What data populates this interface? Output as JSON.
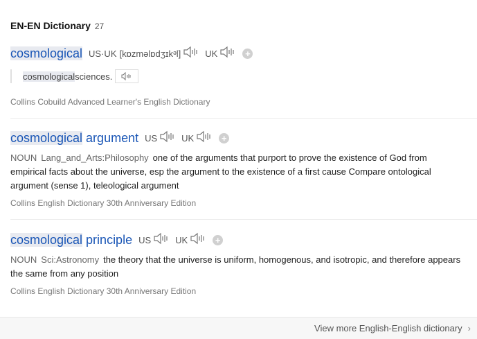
{
  "header": {
    "title": "EN-EN Dictionary",
    "count": "27"
  },
  "entries": [
    {
      "headword_hl": "cosmological",
      "headword_rest": "",
      "us_label": "US·UK",
      "phonetic": "[kɒzməlɒdʒɪkᵊl]",
      "uk_label": "UK",
      "example_hl": "cosmological",
      "example_rest": " sciences.",
      "source": "Collins Cobuild Advanced Learner's English Dictionary"
    },
    {
      "headword_hl": "cosmological",
      "headword_rest": " argument",
      "us_label": "US",
      "uk_label": "UK",
      "pos": "NOUN",
      "domain": "Lang_and_Arts:Philosophy",
      "definition": "one of the arguments that purport to prove the existence of God from empirical facts about the universe, esp the argument to the existence of a first cause Compare ontological argument (sense 1), teleological argument",
      "source": "Collins English Dictionary 30th Anniversary Edition"
    },
    {
      "headword_hl": "cosmological",
      "headword_rest": " principle",
      "us_label": "US",
      "uk_label": "UK",
      "pos": "NOUN",
      "domain": "Sci:Astronomy",
      "definition": "the theory that the universe is uniform, homogenous, and isotropic, and therefore appears the same from any position",
      "source": "Collins English Dictionary 30th Anniversary Edition"
    }
  ],
  "footer": {
    "more_label": "View more English-English dictionary"
  },
  "icons": {
    "speaker": "speaker-icon",
    "add": "plus-icon",
    "chevron": "chevron-right-icon"
  },
  "colors": {
    "headword": "#1a56b6",
    "highlight": "#e8eaf0"
  }
}
